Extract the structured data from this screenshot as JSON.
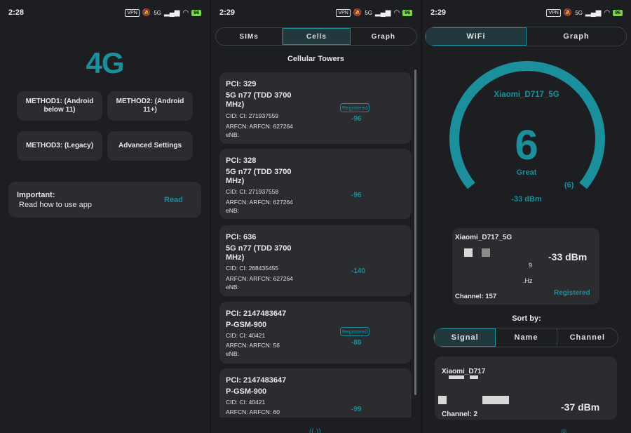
{
  "colors": {
    "accent": "#1b8f9c",
    "card": "#2a2c30",
    "background": "#1c1e21"
  },
  "screens": [
    {
      "status": {
        "time": "2:28",
        "vpn": "VPN",
        "net": "5G",
        "battery": "96"
      },
      "logo": "4G",
      "methods": [
        {
          "label": "METHOD1: (Android below 11)"
        },
        {
          "label": "METHOD2: (Android 11+)"
        },
        {
          "label": "METHOD3: (Legacy)"
        },
        {
          "label": "Advanced Settings"
        }
      ],
      "notice": {
        "title": "Important:",
        "text": "Read how to use app",
        "action": "Read"
      }
    },
    {
      "status": {
        "time": "2:29",
        "vpn": "VPN",
        "net": "5G",
        "battery": "96"
      },
      "tabs": [
        "SIMs",
        "Cells",
        "Graph"
      ],
      "active_tab": "Cells",
      "title": "Cellular Towers",
      "cells": [
        {
          "pci": "PCI: 329",
          "band": "5G n77 (TDD 3700 MHz)",
          "cid": "CID: CI: 271937559",
          "arfcn": "ARFCN: ARFCN: 627264",
          "enb": "eNB:",
          "registered": "Registered",
          "signal": "-96"
        },
        {
          "pci": "PCI: 328",
          "band": "5G n77 (TDD 3700 MHz)",
          "cid": "CID: CI: 271937558",
          "arfcn": "ARFCN: ARFCN: 627264",
          "enb": "eNB:",
          "signal": "-96"
        },
        {
          "pci": "PCI: 636",
          "band": "5G n77 (TDD 3700 MHz)",
          "cid": "CID: CI: 268435455",
          "arfcn": "ARFCN: ARFCN: 627264",
          "enb": "eNB:",
          "signal": "-140"
        },
        {
          "pci": "PCI: 2147483647",
          "band": "P-GSM-900",
          "cid": "CID: CI: 40421",
          "arfcn": "ARFCN: ARFCN: 56",
          "enb": "eNB:",
          "registered": "Registered",
          "signal": "-89"
        },
        {
          "pci": "PCI: 2147483647",
          "band": "P-GSM-900",
          "cid": "CID: CI: 40421",
          "arfcn": "ARFCN: ARFCN: 60",
          "signal": "-99"
        }
      ]
    },
    {
      "status": {
        "time": "2:29",
        "vpn": "VPN",
        "net": "5G",
        "battery": "96"
      },
      "tabs": [
        "WiFi",
        "Graph"
      ],
      "active_tab": "WiFi",
      "gauge": {
        "ssid": "Xiaomi_D717_5G",
        "score": "6",
        "quality": "Great",
        "secondary": "(6)",
        "dbm": "-33 dBm",
        "level_fraction": 0.62
      },
      "ap": {
        "ssid": "Xiaomi_D717_5G",
        "dbm": "-33 dBm",
        "n": "9",
        "freq_suffix": ".Hz",
        "channel": "Channel: 157",
        "status": "Registered"
      },
      "sort": {
        "label": "Sort by:",
        "options": [
          "Signal",
          "Name",
          "Channel"
        ],
        "active": "Signal"
      },
      "ap2": {
        "ssid": "Xiaomi_D717",
        "channel": "Channel: 2",
        "dbm": "-37 dBm"
      }
    }
  ]
}
